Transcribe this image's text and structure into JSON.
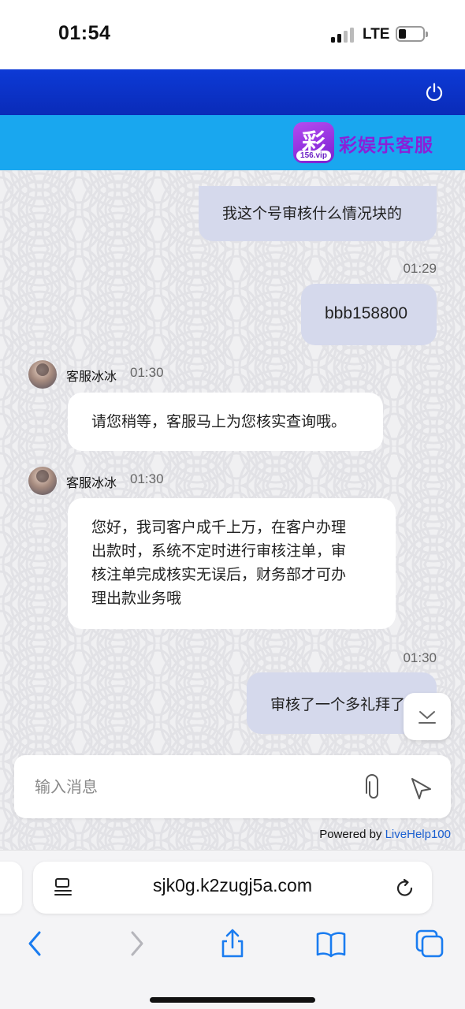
{
  "status_bar": {
    "time": "01:54",
    "network": "LTE",
    "signal_bars": 2,
    "signal_bars_max": 4,
    "battery_level": 0.25
  },
  "header": {
    "brand_logo_char": "彩",
    "brand_logo_sub": "156.vip",
    "brand_name": "彩娱乐客服",
    "colors": {
      "top_band": "#0d3ad6",
      "brand_band": "#19a7ef",
      "brand_text": "#8a20d8"
    }
  },
  "messages": {
    "m1": {
      "text": "我这个号审核什么情况块的"
    },
    "m2": {
      "time": "01:29",
      "text": "bbb158800"
    },
    "m3": {
      "agent": "客服冰冰",
      "time": "01:30",
      "text": "请您稍等，客服马上为您核实查询哦。"
    },
    "m4": {
      "agent": "客服冰冰",
      "time": "01:30",
      "lines": [
        "您好，我司客户成千上万，在客户办理",
        "出款时，系统不定时进行审核注单，审",
        "核注单完成核实无误后，财务部才可办",
        "理出款业务哦"
      ]
    },
    "m5": {
      "time": "01:30",
      "text": "审核了一个多礼拜了"
    }
  },
  "composer": {
    "placeholder": "输入消息",
    "attach_icon": "paperclip-icon",
    "send_icon": "send-icon",
    "scroll_icon": "chevron-down-icon"
  },
  "footer": {
    "powered_prefix": "Powered by",
    "powered_brand": "LiveHelp100"
  },
  "browser": {
    "url": "sjk0g.k2zugj5a.com",
    "accent": "#1a7cf0"
  }
}
